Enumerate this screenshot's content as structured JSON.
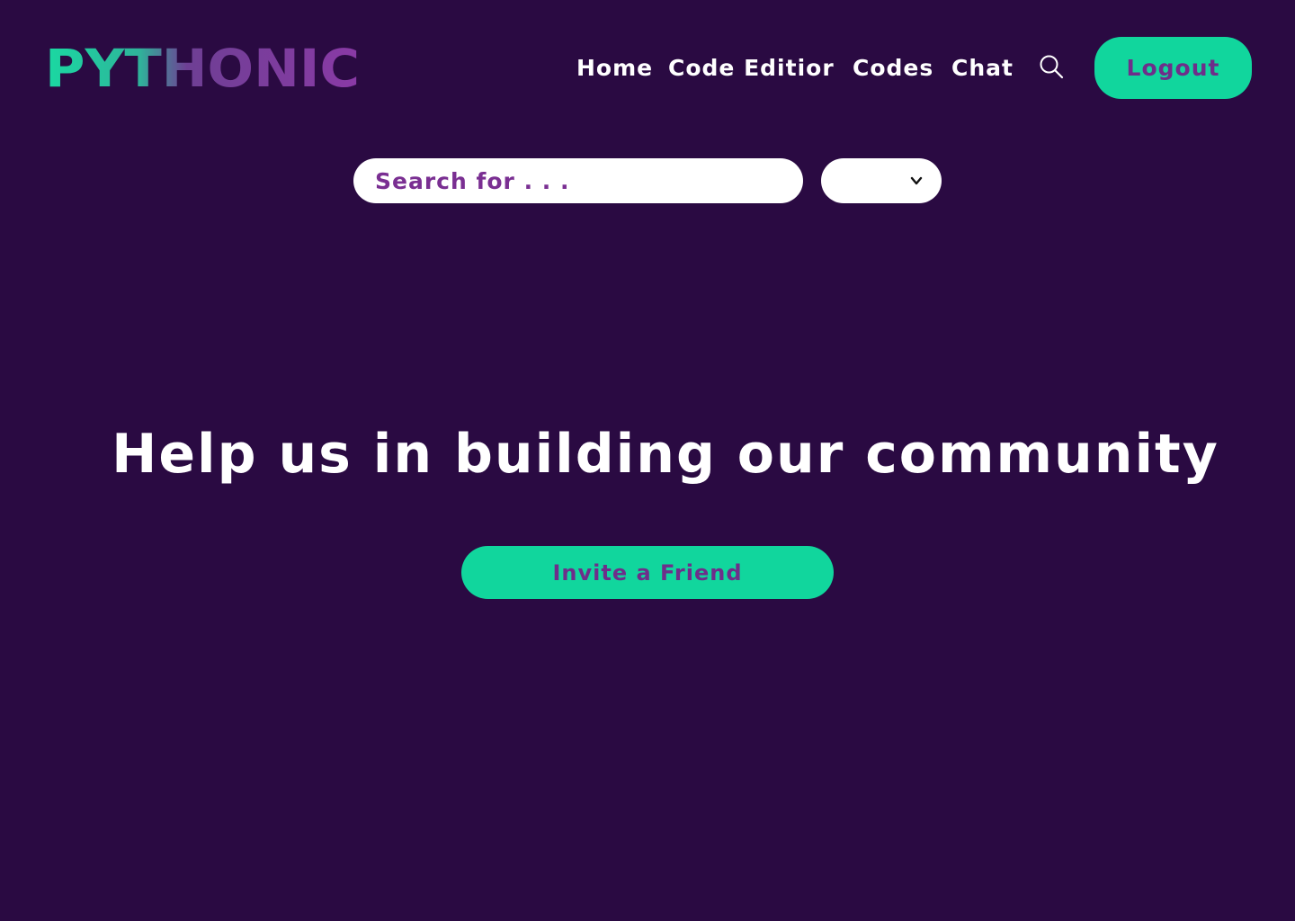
{
  "brand": {
    "logo_text": "PYTHONIC",
    "gradient_start": "#1ad9a2",
    "gradient_end": "#8a3aa6"
  },
  "nav": {
    "items": [
      {
        "label": "Home"
      },
      {
        "label": "Code Editior"
      },
      {
        "label": "Codes"
      },
      {
        "label": "Chat"
      }
    ],
    "search_icon": "search-icon",
    "logout_label": "Logout"
  },
  "search": {
    "placeholder": "Search for . . .",
    "value": "",
    "select_value": "",
    "select_icon": "chevron-down-icon"
  },
  "hero": {
    "title": "Help us in building our community",
    "invite_label": "Invite a Friend"
  },
  "colors": {
    "background": "#2a0a42",
    "accent": "#11d69d",
    "accent_text": "#6e2e8a",
    "text": "#ffffff"
  }
}
